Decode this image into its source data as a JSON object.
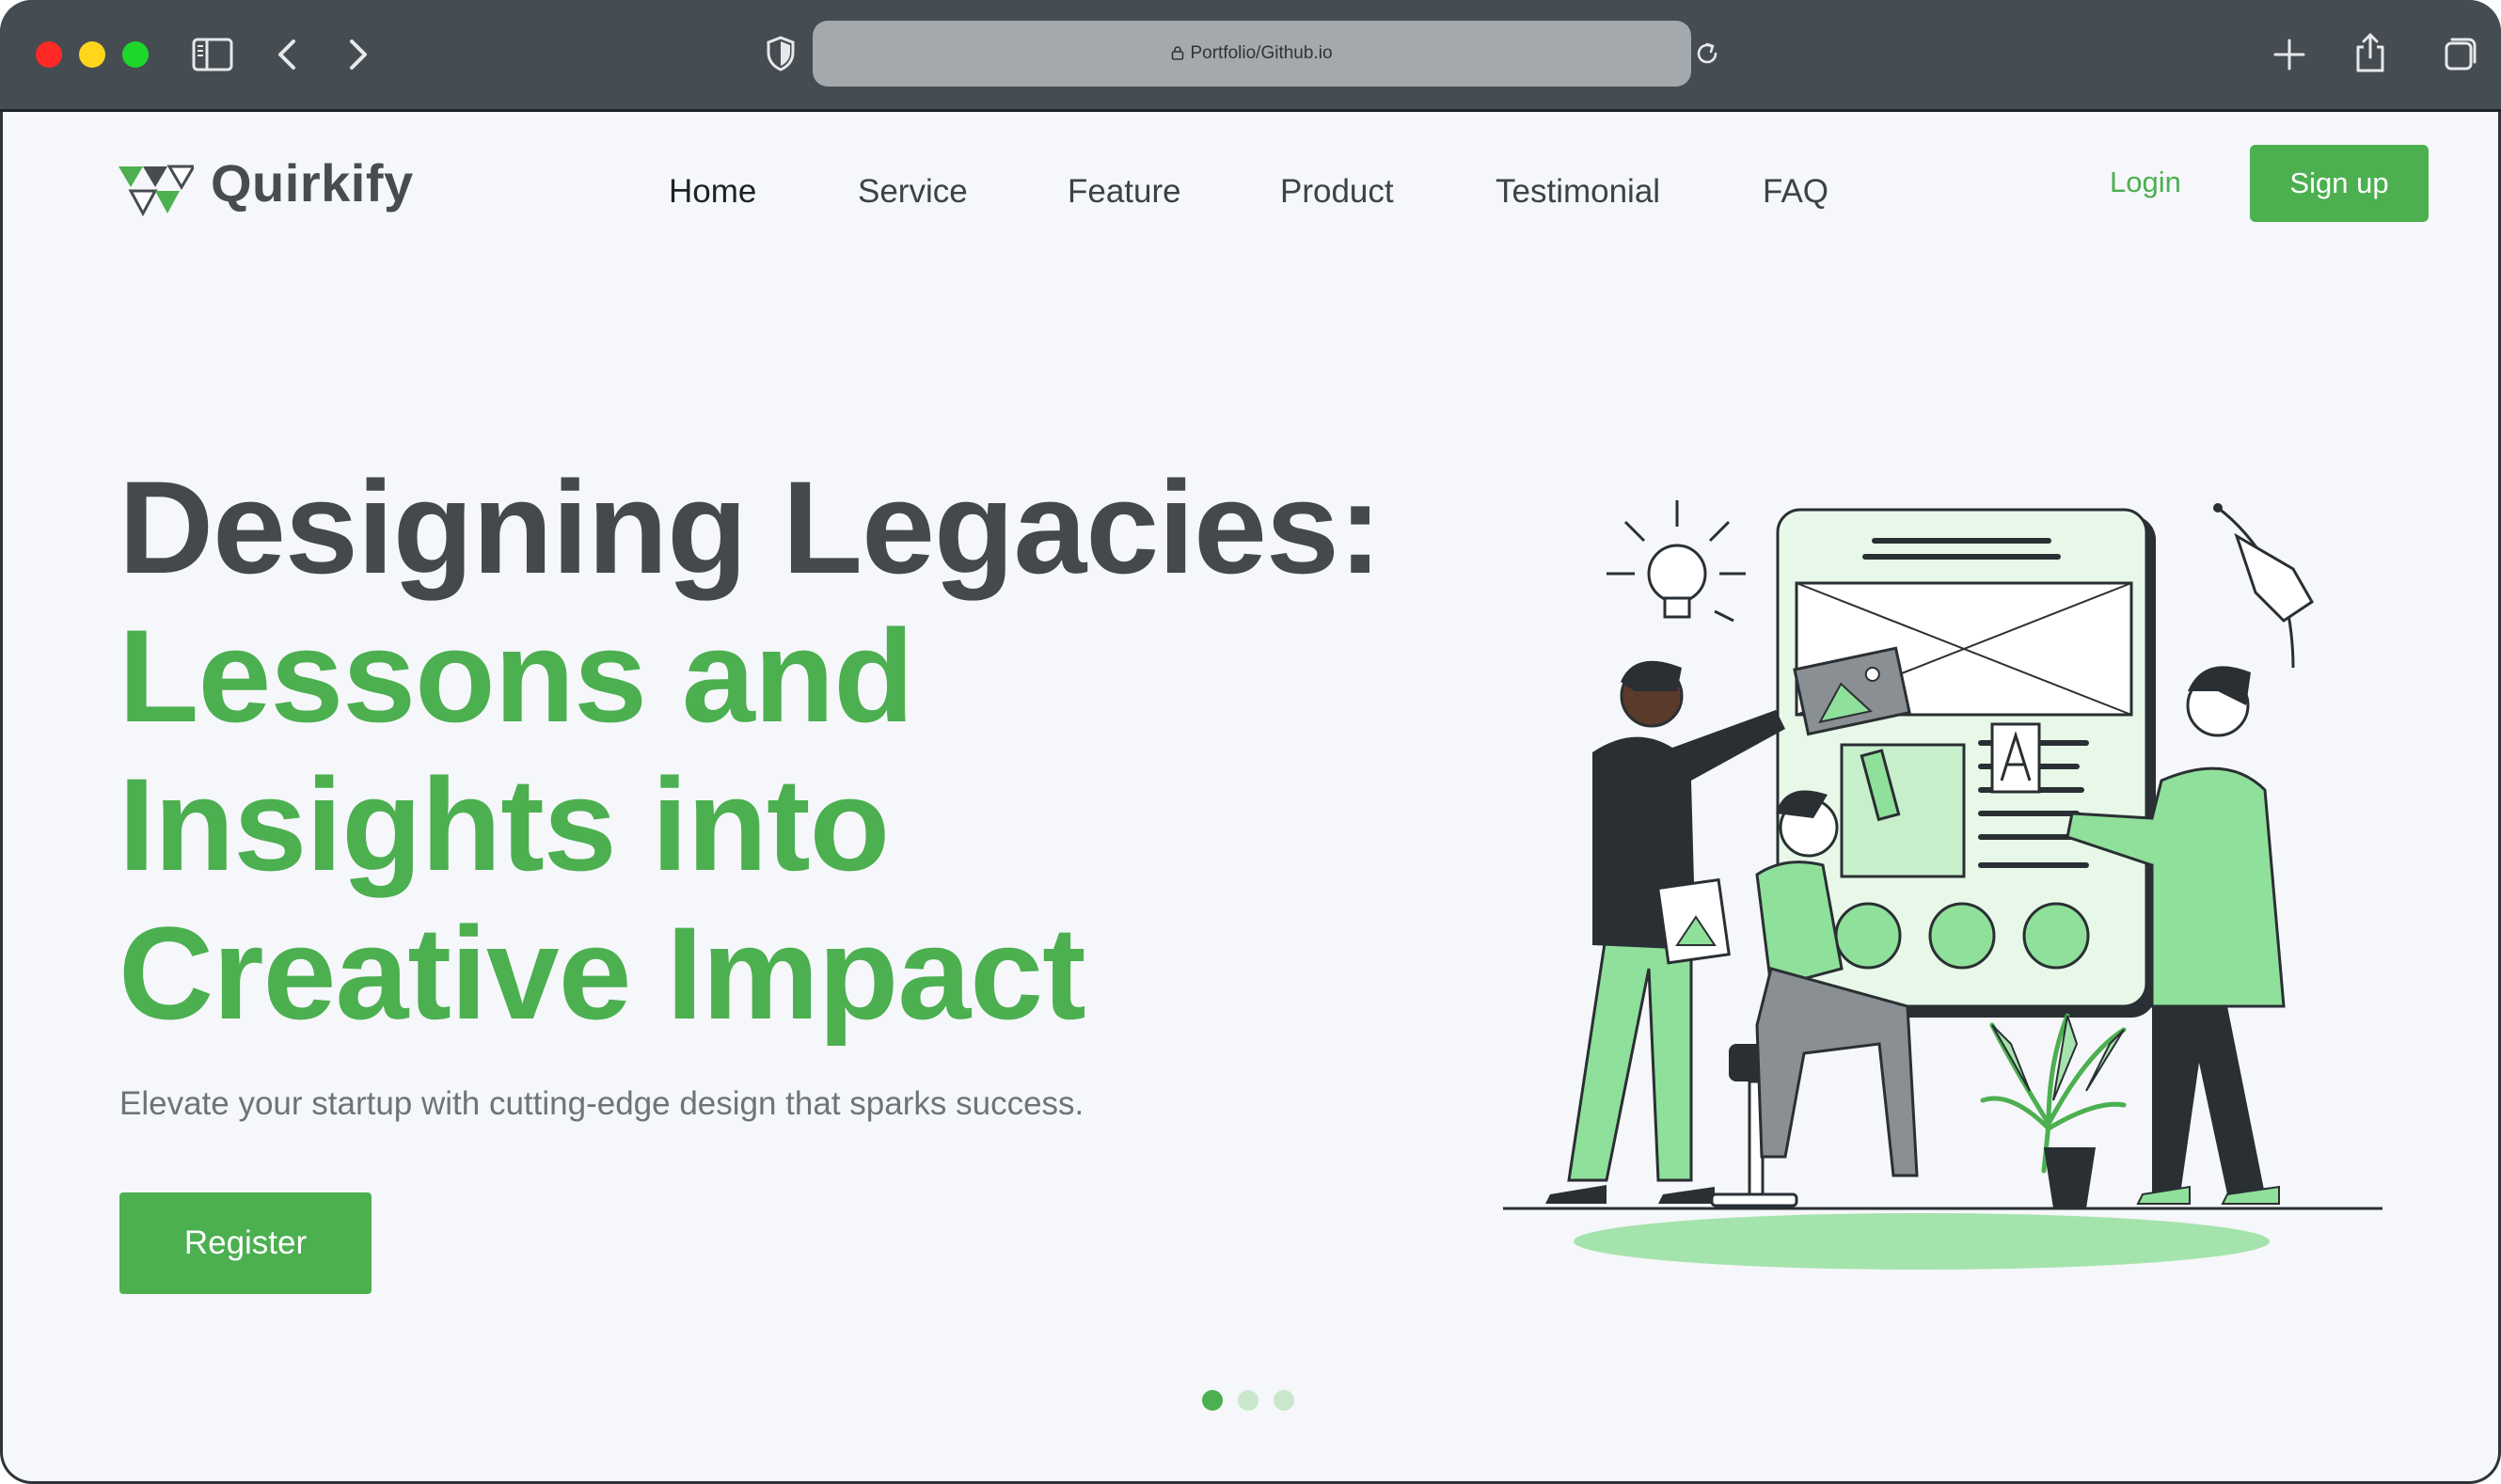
{
  "browser": {
    "url": "Portfolio/Github.io"
  },
  "nav": {
    "brand": "Quirkify",
    "items": [
      "Home",
      "Service",
      "Feature",
      "Product",
      "Testimonial",
      "FAQ"
    ],
    "login": "Login",
    "signup": "Sign up"
  },
  "hero": {
    "headline_line1": "Designing Legacies:",
    "headline_line2": "Lessons and",
    "headline_line3": "Insights into",
    "headline_line4": "Creative Impact",
    "subtext": "Elevate your startup with cutting-edge design that sparks success.",
    "cta": "Register"
  },
  "carousel": {
    "slides": 3,
    "active_slide": 1
  },
  "colors": {
    "accent": "#4caf50",
    "accent_light": "#a5d6a7",
    "headline_dark": "#46494c",
    "chrome": "#454c52"
  }
}
